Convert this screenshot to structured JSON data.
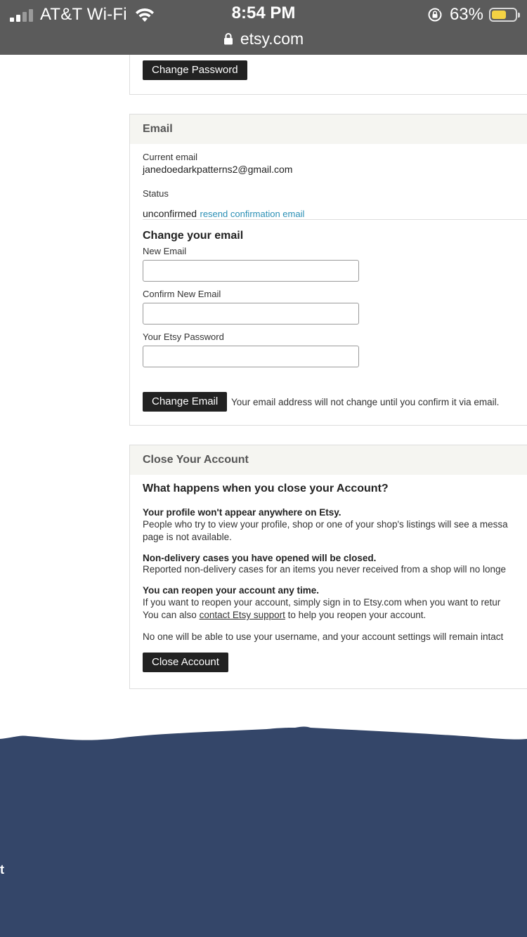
{
  "status_bar": {
    "carrier": "AT&T Wi-Fi",
    "time": "8:54 PM",
    "battery_percent": "63%",
    "battery_level": 0.63,
    "signal_bars_filled": 2,
    "url": "etsy.com"
  },
  "password_section": {
    "change_password_button": "Change Password"
  },
  "email_section": {
    "title": "Email",
    "current_email_label": "Current email",
    "current_email_value": "janedoedarkpatterns2@gmail.com",
    "status_label": "Status",
    "status_value": "unconfirmed",
    "resend_link": "resend confirmation email",
    "change_heading": "Change your email",
    "new_email_label": "New Email",
    "new_email_value": "",
    "confirm_email_label": "Confirm New Email",
    "confirm_email_value": "",
    "password_label": "Your Etsy Password",
    "password_value": "",
    "change_email_button": "Change Email",
    "change_email_note": "Your email address will not change until you confirm it via email."
  },
  "close_section": {
    "title": "Close Your Account",
    "heading": "What happens when you close your Account?",
    "item1_title": "Your profile won't appear anywhere on Etsy.",
    "item1_line1": "People who try to view your profile, shop or one of your shop's listings will see a messa",
    "item1_line2": "page is not available.",
    "item2_title": "Non-delivery cases you have opened will be closed.",
    "item2_line1": "Reported non-delivery cases for an items you never received from a shop will no longe",
    "item3_title": "You can reopen your account any time.",
    "item3_line1": "If you want to reopen your account, simply sign in to Etsy.com when you want to retur",
    "item3_line2_pre": "You can also ",
    "item3_link": "contact Etsy support",
    "item3_line2_post": " to help you reopen your account.",
    "final_note": "No one will be able to use your username, and your account settings will remain intact",
    "close_button": "Close Account"
  },
  "footer": {
    "fragment": "t"
  },
  "colors": {
    "topbar": "#5b5b5b",
    "panel_header": "#f5f5f1",
    "button": "#222222",
    "link": "#2a8fb5",
    "footer": "#344669",
    "battery": "#f3d243"
  }
}
